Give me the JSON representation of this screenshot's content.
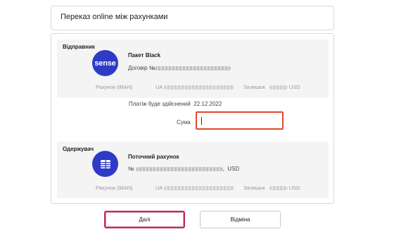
{
  "header": {
    "title": "Переказ online між рахунками"
  },
  "sender": {
    "section_label": "Відправник",
    "logo_text": "sense",
    "product_name": "Пакет Black",
    "contract_label": "Договір №",
    "account_label": "Рахунок (IBAN)",
    "iban_prefix": "UA",
    "balance_label": "Залишок",
    "currency": "USD"
  },
  "payment": {
    "date_label": "Платіж буде здійснений",
    "date_value": "22.12.2022",
    "amount_label": "Сума",
    "amount_value": ""
  },
  "receiver": {
    "section_label": "Одержувач",
    "icon": "wallet-cards-icon",
    "product_name": "Поточний рахунок",
    "number_label": "№",
    "number_suffix": ",",
    "number_currency": "USD",
    "account_label": "Рахунок (IBAN)",
    "iban_prefix": "UA",
    "balance_label": "Залишок",
    "currency": "USD"
  },
  "buttons": {
    "next_label": "Далі",
    "cancel_label": "Відміна"
  },
  "colors": {
    "accent_blue": "#2e3bc7",
    "input_border": "#e04a2a",
    "primary_button_border": "#c0275a"
  }
}
